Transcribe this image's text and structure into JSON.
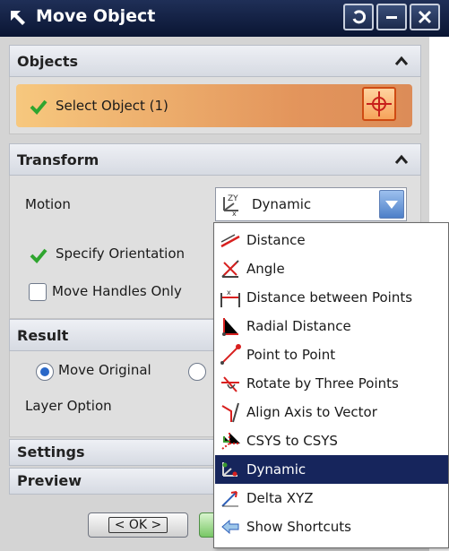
{
  "window": {
    "title": "Move Object"
  },
  "sections": {
    "objects": {
      "header": "Objects",
      "select_label": "Select Object (1)"
    },
    "transform": {
      "header": "Transform",
      "motion_label": "Motion",
      "motion_value": "Dynamic",
      "specify_orientation": "Specify Orientation",
      "move_handles_only": "Move Handles Only"
    },
    "result": {
      "header": "Result",
      "move_original": "Move Original",
      "layer_option": "Layer Option"
    },
    "settings": {
      "header": "Settings"
    },
    "preview": {
      "header": "Preview"
    }
  },
  "footer": {
    "ok_label": "< OK >"
  },
  "motion_options": [
    {
      "label": "Distance",
      "icon": "distance-icon"
    },
    {
      "label": "Angle",
      "icon": "angle-icon"
    },
    {
      "label": "Distance between Points",
      "icon": "distance-between-points-icon"
    },
    {
      "label": "Radial Distance",
      "icon": "radial-distance-icon"
    },
    {
      "label": "Point to Point",
      "icon": "point-to-point-icon"
    },
    {
      "label": "Rotate by Three Points",
      "icon": "rotate-three-points-icon"
    },
    {
      "label": "Align Axis to Vector",
      "icon": "align-axis-icon"
    },
    {
      "label": "CSYS to CSYS",
      "icon": "csys-icon"
    },
    {
      "label": "Dynamic",
      "icon": "dynamic-icon",
      "selected": true
    },
    {
      "label": "Delta XYZ",
      "icon": "delta-xyz-icon"
    },
    {
      "label": "Show Shortcuts",
      "icon": "show-shortcuts-icon"
    }
  ],
  "colors": {
    "titlebar": "#0a1533",
    "select_highlight": "#e3955c",
    "list_selection": "#16255c",
    "check_green": "#2fa52f"
  }
}
